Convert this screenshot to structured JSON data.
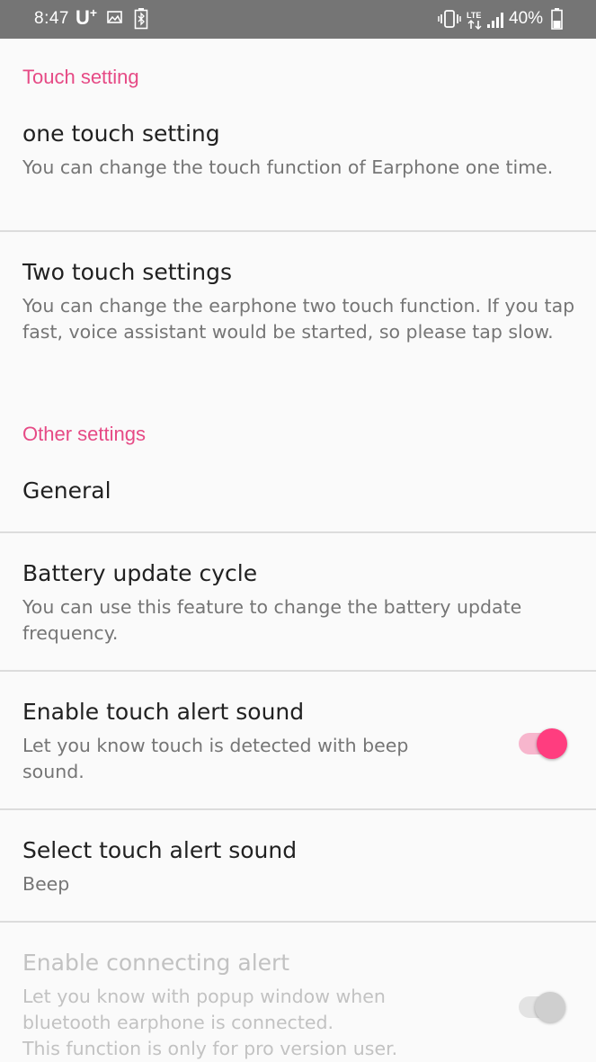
{
  "status_bar": {
    "time": "8:47",
    "carrier": "U",
    "carrier_plus": "+",
    "battery_percent": "40%",
    "icons": [
      "gallery-icon",
      "bluetooth-battery-icon",
      "vibrate-icon",
      "lte-icon",
      "signal-icon",
      "battery-icon"
    ]
  },
  "sections": {
    "touch": {
      "header": "Touch setting",
      "one_touch": {
        "title": "one touch setting",
        "summary": "You can change the touch function of Earphone one time."
      },
      "two_touch": {
        "title": "Two touch settings",
        "summary": "You can change the earphone two touch function. If you tap fast, voice assistant would be started, so please tap slow."
      }
    },
    "other": {
      "header": "Other settings",
      "general": {
        "title": "General"
      },
      "battery_cycle": {
        "title": "Battery update cycle",
        "summary": "You can use this feature to change the battery update frequency."
      },
      "touch_alert": {
        "title": "Enable touch alert sound",
        "summary": "Let you know touch is detected with beep sound.",
        "enabled": true
      },
      "select_sound": {
        "title": "Select touch alert sound",
        "summary": "Beep"
      },
      "connecting_alert": {
        "title": "Enable connecting alert",
        "summary_line1": "Let you know with popup window when",
        "summary_line2": "bluetooth earphone is connected.",
        "summary_line3": "This function is only for pro version user.",
        "enabled": false,
        "disabled": true
      }
    }
  },
  "colors": {
    "accent": "#e64a85",
    "switch_on": "#ff3d7f",
    "status_bar": "#757575",
    "divider": "#dcdcdc"
  }
}
